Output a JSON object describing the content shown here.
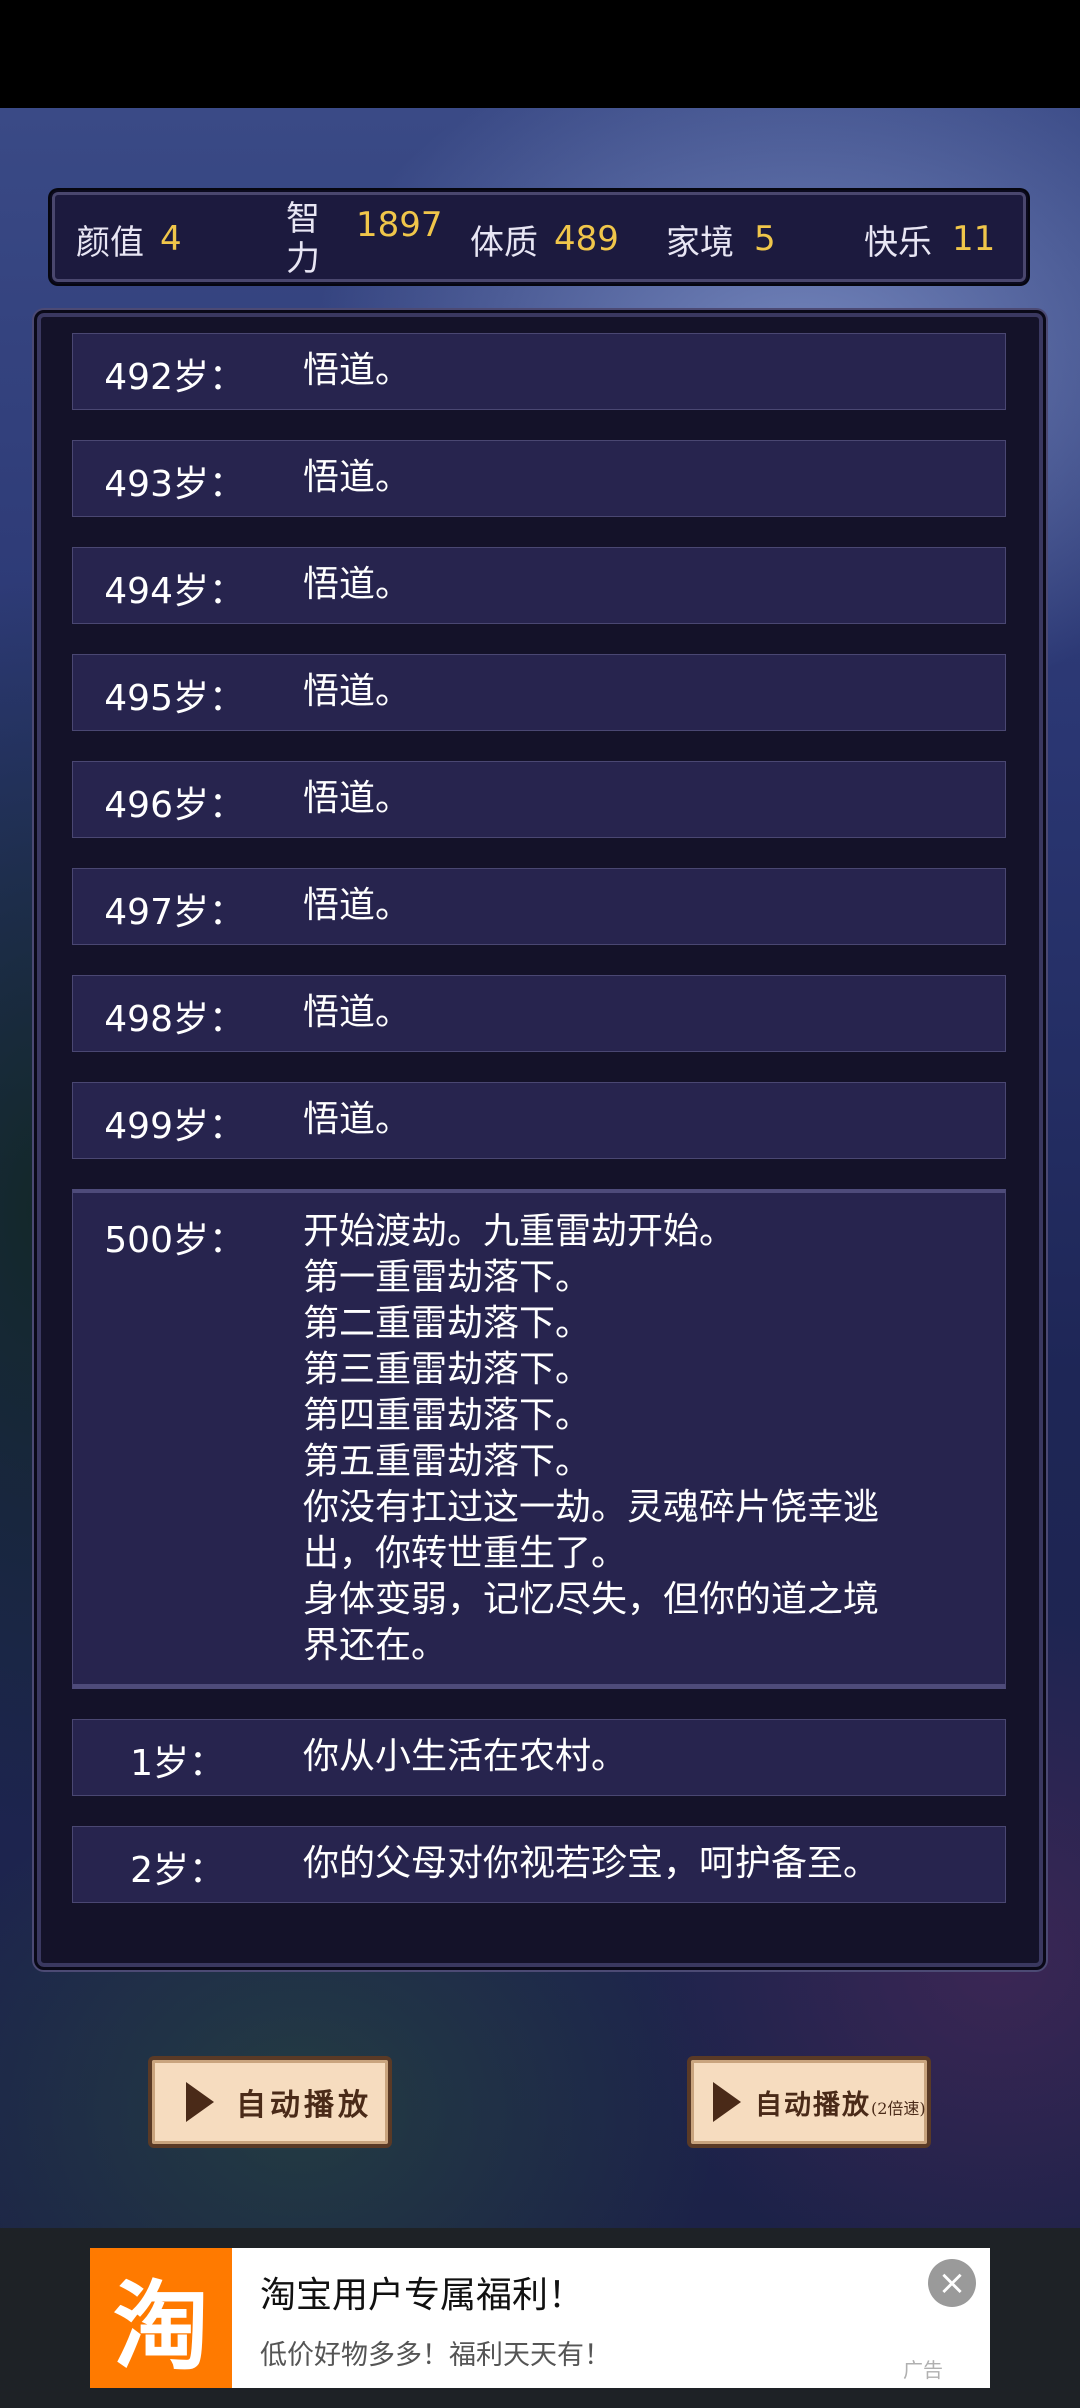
{
  "stats": [
    {
      "label": "颜值",
      "value": "4"
    },
    {
      "label": "智力",
      "value": "1897"
    },
    {
      "label": "体质",
      "value": "489"
    },
    {
      "label": "家境",
      "value": "5"
    },
    {
      "label": "快乐",
      "value": "11"
    }
  ],
  "events": [
    {
      "age": "492岁：",
      "lines": [
        "悟道。"
      ]
    },
    {
      "age": "493岁：",
      "lines": [
        "悟道。"
      ]
    },
    {
      "age": "494岁：",
      "lines": [
        "悟道。"
      ]
    },
    {
      "age": "495岁：",
      "lines": [
        "悟道。"
      ]
    },
    {
      "age": "496岁：",
      "lines": [
        "悟道。"
      ]
    },
    {
      "age": "497岁：",
      "lines": [
        "悟道。"
      ]
    },
    {
      "age": "498岁：",
      "lines": [
        "悟道。"
      ]
    },
    {
      "age": "499岁：",
      "lines": [
        "悟道。"
      ]
    },
    {
      "age": "500岁：",
      "lines": [
        "开始渡劫。九重雷劫开始。",
        "第一重雷劫落下。",
        "第二重雷劫落下。",
        "第三重雷劫落下。",
        "第四重雷劫落下。",
        "第五重雷劫落下。",
        "你没有扛过这一劫。灵魂碎片侥幸逃",
        "出，你转世重生了。",
        "身体变弱，记忆尽失，但你的道之境",
        "界还在。"
      ]
    },
    {
      "age": "1岁：",
      "lines": [
        "你从小生活在农村。"
      ]
    },
    {
      "age": "2岁：",
      "lines": [
        "你的父母对你视若珍宝，呵护备至。"
      ]
    }
  ],
  "buttons": {
    "autoplay": "自动播放",
    "autoplay_fast": "自动播放",
    "autoplay_fast_suffix": "(2倍速)"
  },
  "ad": {
    "logo_char": "淘",
    "title": "淘宝用户专属福利！",
    "subtitle": "低价好物多多！福利天天有！",
    "mark": "广告",
    "close_glyph": "×"
  }
}
